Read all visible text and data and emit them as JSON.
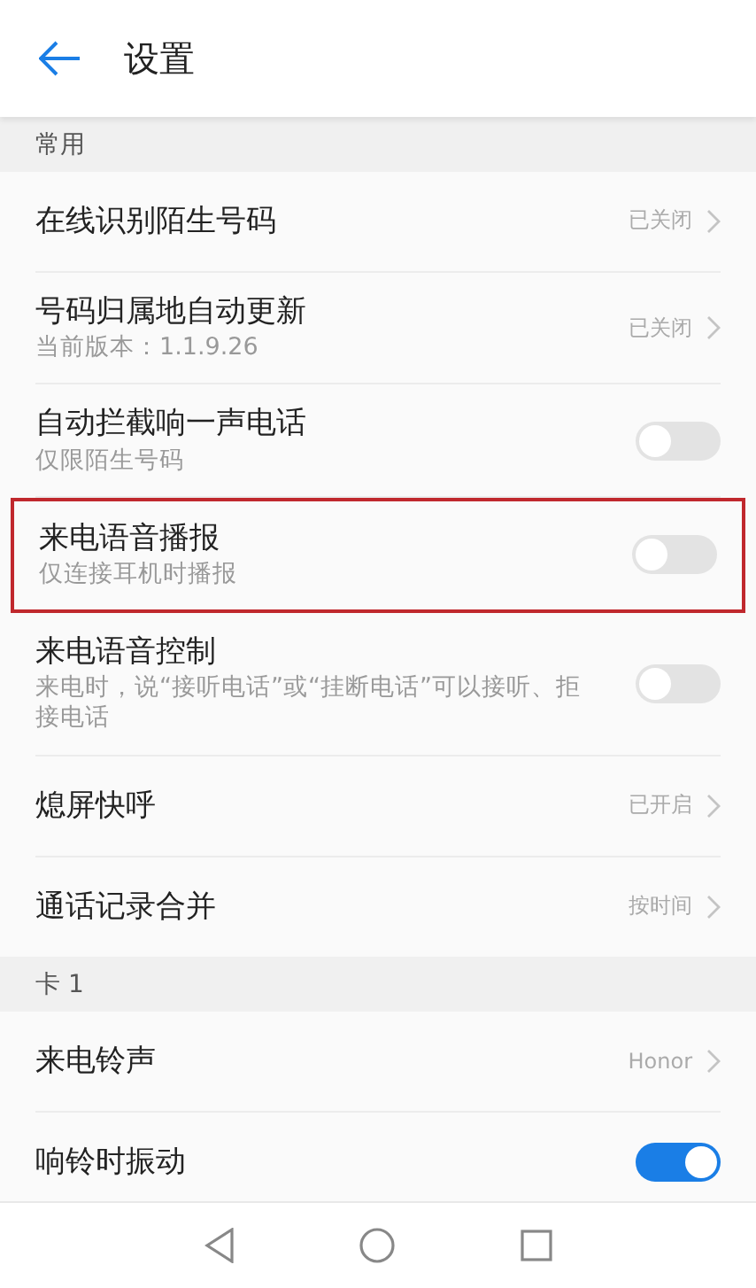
{
  "header": {
    "title": "设置"
  },
  "sections": [
    {
      "title": "常用",
      "rows": [
        {
          "kind": "value",
          "label": "在线识别陌生号码",
          "value": "已关闭",
          "highlighted": false
        },
        {
          "kind": "value",
          "label": "号码归属地自动更新",
          "subtitle": "当前版本：1.1.9.26",
          "value": "已关闭",
          "highlighted": false
        },
        {
          "kind": "toggle",
          "label": "自动拦截响一声电话",
          "subtitle": "仅限陌生号码",
          "on": false,
          "highlighted": false
        },
        {
          "kind": "toggle",
          "label": "来电语音播报",
          "subtitle": "仅连接耳机时播报",
          "on": false,
          "highlighted": true
        },
        {
          "kind": "toggle",
          "label": "来电语音控制",
          "subtitle": "来电时，说“接听电话”或“挂断电话”可以接听、拒接电话",
          "on": false,
          "highlighted": false
        },
        {
          "kind": "value",
          "label": "熄屏快呼",
          "value": "已开启",
          "highlighted": false
        },
        {
          "kind": "value",
          "label": "通话记录合并",
          "value": "按时间",
          "highlighted": false
        }
      ]
    },
    {
      "title": "卡 1",
      "rows": [
        {
          "kind": "value",
          "label": "来电铃声",
          "value": "Honor",
          "highlighted": false
        },
        {
          "kind": "toggle",
          "label": "响铃时振动",
          "on": true,
          "highlighted": false
        }
      ]
    }
  ]
}
